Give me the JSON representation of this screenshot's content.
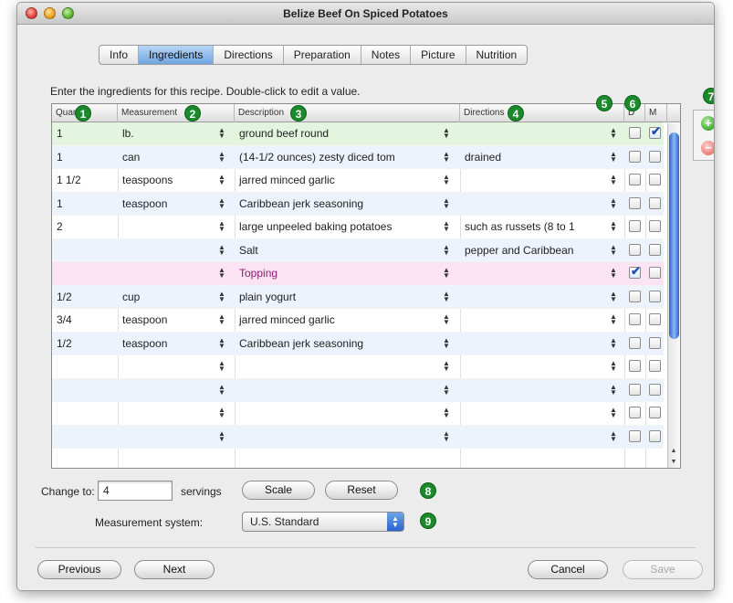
{
  "window": {
    "title": "Belize Beef On Spiced Potatoes"
  },
  "tabs": [
    {
      "label": "Info"
    },
    {
      "label": "Ingredients"
    },
    {
      "label": "Directions"
    },
    {
      "label": "Preparation"
    },
    {
      "label": "Notes"
    },
    {
      "label": "Picture"
    },
    {
      "label": "Nutrition"
    }
  ],
  "active_tab": "Ingredients",
  "instructions": "Enter the ingredients for this recipe. Double-click to edit a value.",
  "table": {
    "headers": {
      "quantity": "Quantity",
      "measurement": "Measurement",
      "description": "Description",
      "directions": "Directions",
      "d": "D",
      "m": "M"
    },
    "rows": [
      {
        "quantity": "1",
        "measurement": "lb.",
        "description": "ground beef round",
        "directions": "",
        "d": false,
        "m": true
      },
      {
        "quantity": "1",
        "measurement": "can",
        "description": "(14-1/2 ounces) zesty diced tom",
        "directions": "drained",
        "d": false,
        "m": false
      },
      {
        "quantity": "1 1/2",
        "measurement": "teaspoons",
        "description": "jarred minced garlic",
        "directions": "",
        "d": false,
        "m": false
      },
      {
        "quantity": "1",
        "measurement": "teaspoon",
        "description": "Caribbean jerk seasoning",
        "directions": "",
        "d": false,
        "m": false
      },
      {
        "quantity": "2",
        "measurement": "",
        "description": "large unpeeled baking potatoes",
        "directions": "such as russets (8 to 1",
        "d": false,
        "m": false
      },
      {
        "quantity": "",
        "measurement": "",
        "description": "Salt",
        "directions": "pepper and Caribbean",
        "d": false,
        "m": false
      },
      {
        "quantity": "",
        "measurement": "",
        "description": "Topping",
        "directions": "",
        "d": true,
        "m": false
      },
      {
        "quantity": "1/2",
        "measurement": "cup",
        "description": "plain yogurt",
        "directions": "",
        "d": false,
        "m": false
      },
      {
        "quantity": "3/4",
        "measurement": "teaspoon",
        "description": "jarred minced garlic",
        "directions": "",
        "d": false,
        "m": false
      },
      {
        "quantity": "1/2",
        "measurement": "teaspoon",
        "description": "Caribbean jerk seasoning",
        "directions": "",
        "d": false,
        "m": false
      },
      {
        "quantity": "",
        "measurement": "",
        "description": "",
        "directions": "",
        "d": false,
        "m": false
      },
      {
        "quantity": "",
        "measurement": "",
        "description": "",
        "directions": "",
        "d": false,
        "m": false
      },
      {
        "quantity": "",
        "measurement": "",
        "description": "",
        "directions": "",
        "d": false,
        "m": false
      },
      {
        "quantity": "",
        "measurement": "",
        "description": "",
        "directions": "",
        "d": false,
        "m": false
      }
    ]
  },
  "callouts": [
    "1",
    "2",
    "3",
    "4",
    "5",
    "6",
    "7",
    "8",
    "9"
  ],
  "side_buttons": {
    "add": "+",
    "remove": "−"
  },
  "servings": {
    "label": "Change to:",
    "value": "4",
    "unit_label": "servings",
    "scale_label": "Scale",
    "reset_label": "Reset"
  },
  "measurement_system": {
    "label": "Measurement system:",
    "value": "U.S. Standard"
  },
  "footer": {
    "previous_label": "Previous",
    "next_label": "Next",
    "cancel_label": "Cancel",
    "save_label": "Save"
  },
  "colors": {
    "accent": "#2a63d0",
    "callout": "#1a8a2a",
    "topping_row": "#fbe3f3",
    "selected_row": "#e3f5df"
  }
}
